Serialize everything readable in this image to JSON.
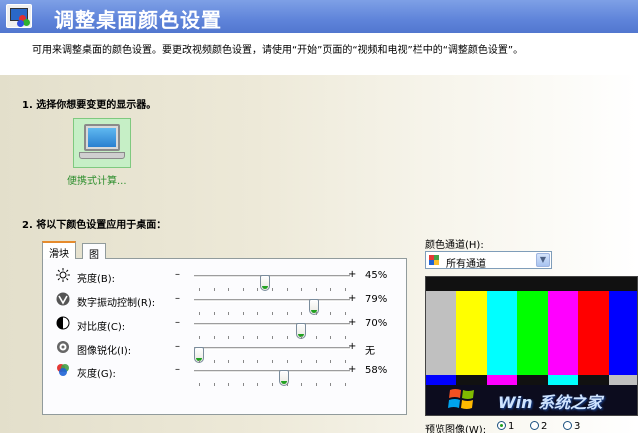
{
  "header": {
    "title": "调整桌面颜色设置"
  },
  "description": "可用来调整桌面的颜色设置。要更改视频颜色设置，请使用“开始”页面的“视频和电视”栏中的“调整颜色设置”。",
  "step1": {
    "title": "1. 选择你想要变更的显示器。",
    "display_label": "便携式计算..."
  },
  "step2": {
    "title": "2. 将以下颜色设置应用于桌面：",
    "tabs": [
      {
        "label": "滑块"
      },
      {
        "label": "图"
      }
    ],
    "sliders": [
      {
        "label": "亮度(B):",
        "icon": "brightness-icon",
        "value": "45%",
        "level": 45
      },
      {
        "label": "数字振动控制(R):",
        "icon": "vibrance-icon",
        "value": "79%",
        "level": 79
      },
      {
        "label": "对比度(C):",
        "icon": "contrast-icon",
        "value": "70%",
        "level": 70
      },
      {
        "label": "图像锐化(I):",
        "icon": "sharpen-icon",
        "value": "无",
        "level": 0
      },
      {
        "label": "灰度(G):",
        "icon": "gamma-icon",
        "value": "58%",
        "level": 58
      }
    ],
    "minus": "–",
    "plus": "+"
  },
  "color_channel": {
    "label": "颜色通道(H):",
    "selected": "所有通道"
  },
  "preview": {
    "label": "预览图像(W):",
    "options": [
      "1",
      "2",
      "3"
    ],
    "selected_index": 0,
    "bar_colors": [
      "#c0c0c0",
      "#ffff00",
      "#00ffff",
      "#00ff00",
      "#ff00ff",
      "#ff0000",
      "#0000ff"
    ],
    "strip_colors": [
      "#0000ff",
      "#111111",
      "#ff00ff",
      "#111111",
      "#00ffff",
      "#111111",
      "#c0c0c0"
    ]
  },
  "watermark": "Win 系统之家"
}
